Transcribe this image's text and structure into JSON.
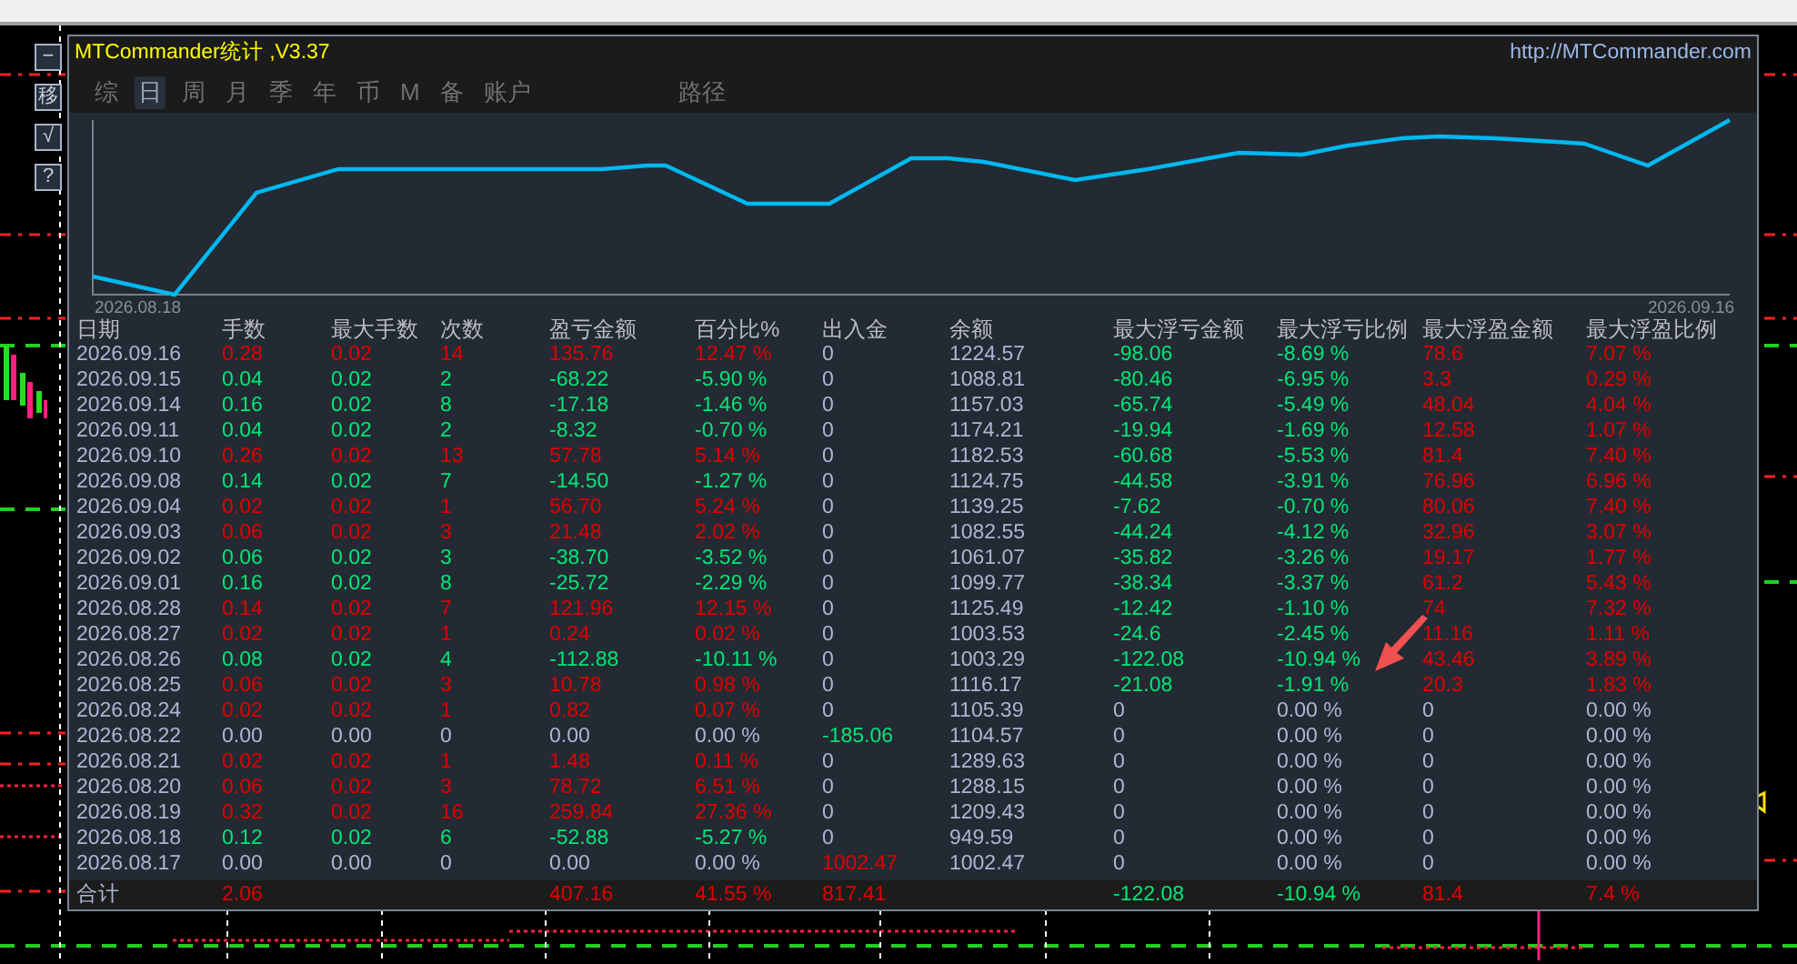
{
  "side_buttons": [
    "−",
    "移",
    "√",
    "?"
  ],
  "window": {
    "title": "MTCommander统计 ,V3.37",
    "link": "http://MTCommander.com"
  },
  "tabs": [
    {
      "label": "综",
      "selected": false
    },
    {
      "label": "日",
      "selected": true
    },
    {
      "label": "周",
      "selected": false
    },
    {
      "label": "月",
      "selected": false
    },
    {
      "label": "季",
      "selected": false
    },
    {
      "label": "年",
      "selected": false
    },
    {
      "label": "币",
      "selected": false
    },
    {
      "label": "M",
      "selected": false
    },
    {
      "label": "备",
      "selected": false
    },
    {
      "label": "账户",
      "selected": false
    },
    {
      "label": "路径",
      "selected": false
    }
  ],
  "equity_chart": {
    "start_label": "2026.08.18",
    "end_label": "2026.09.16"
  },
  "table": {
    "columns": [
      "日期",
      "手数",
      "最大手数",
      "次数",
      "盈亏金额",
      "百分比%",
      "出入金",
      "余额",
      "最大浮亏金额",
      "最大浮亏比例",
      "最大浮盈金额",
      "最大浮盈比例"
    ],
    "rows": [
      {
        "cells": [
          {
            "text": "2026.09.16",
            "color": "#aab6d3"
          },
          {
            "text": "0.28",
            "color": "#e00000"
          },
          {
            "text": "0.02",
            "color": "#e00000"
          },
          {
            "text": "14",
            "color": "#e00000"
          },
          {
            "text": "135.76",
            "color": "#e00000"
          },
          {
            "text": "12.47 %",
            "color": "#e00000"
          },
          {
            "text": "0",
            "color": "#aab6d3"
          },
          {
            "text": "1224.57",
            "color": "#aab6d3"
          },
          {
            "text": "-98.06",
            "color": "#00e676"
          },
          {
            "text": "-8.69 %",
            "color": "#00e676"
          },
          {
            "text": "78.6",
            "color": "#e00000"
          },
          {
            "text": "7.07 %",
            "color": "#e00000"
          }
        ]
      },
      {
        "cells": [
          {
            "text": "2026.09.15",
            "color": "#aab6d3"
          },
          {
            "text": "0.04",
            "color": "#00e676"
          },
          {
            "text": "0.02",
            "color": "#00e676"
          },
          {
            "text": "2",
            "color": "#00e676"
          },
          {
            "text": "-68.22",
            "color": "#00e676"
          },
          {
            "text": "-5.90 %",
            "color": "#00e676"
          },
          {
            "text": "0",
            "color": "#aab6d3"
          },
          {
            "text": "1088.81",
            "color": "#aab6d3"
          },
          {
            "text": "-80.46",
            "color": "#00e676"
          },
          {
            "text": "-6.95 %",
            "color": "#00e676"
          },
          {
            "text": "3.3",
            "color": "#e00000"
          },
          {
            "text": "0.29 %",
            "color": "#e00000"
          }
        ]
      },
      {
        "cells": [
          {
            "text": "2026.09.14",
            "color": "#aab6d3"
          },
          {
            "text": "0.16",
            "color": "#00e676"
          },
          {
            "text": "0.02",
            "color": "#00e676"
          },
          {
            "text": "8",
            "color": "#00e676"
          },
          {
            "text": "-17.18",
            "color": "#00e676"
          },
          {
            "text": "-1.46 %",
            "color": "#00e676"
          },
          {
            "text": "0",
            "color": "#aab6d3"
          },
          {
            "text": "1157.03",
            "color": "#aab6d3"
          },
          {
            "text": "-65.74",
            "color": "#00e676"
          },
          {
            "text": "-5.49 %",
            "color": "#00e676"
          },
          {
            "text": "48.04",
            "color": "#e00000"
          },
          {
            "text": "4.04 %",
            "color": "#e00000"
          }
        ]
      },
      {
        "cells": [
          {
            "text": "2026.09.11",
            "color": "#aab6d3"
          },
          {
            "text": "0.04",
            "color": "#00e676"
          },
          {
            "text": "0.02",
            "color": "#00e676"
          },
          {
            "text": "2",
            "color": "#00e676"
          },
          {
            "text": "-8.32",
            "color": "#00e676"
          },
          {
            "text": "-0.70 %",
            "color": "#00e676"
          },
          {
            "text": "0",
            "color": "#aab6d3"
          },
          {
            "text": "1174.21",
            "color": "#aab6d3"
          },
          {
            "text": "-19.94",
            "color": "#00e676"
          },
          {
            "text": "-1.69 %",
            "color": "#00e676"
          },
          {
            "text": "12.58",
            "color": "#e00000"
          },
          {
            "text": "1.07 %",
            "color": "#e00000"
          }
        ]
      },
      {
        "cells": [
          {
            "text": "2026.09.10",
            "color": "#aab6d3"
          },
          {
            "text": "0.26",
            "color": "#e00000"
          },
          {
            "text": "0.02",
            "color": "#e00000"
          },
          {
            "text": "13",
            "color": "#e00000"
          },
          {
            "text": "57.78",
            "color": "#e00000"
          },
          {
            "text": "5.14 %",
            "color": "#e00000"
          },
          {
            "text": "0",
            "color": "#aab6d3"
          },
          {
            "text": "1182.53",
            "color": "#aab6d3"
          },
          {
            "text": "-60.68",
            "color": "#00e676"
          },
          {
            "text": "-5.53 %",
            "color": "#00e676"
          },
          {
            "text": "81.4",
            "color": "#e00000"
          },
          {
            "text": "7.40 %",
            "color": "#e00000"
          }
        ]
      },
      {
        "cells": [
          {
            "text": "2026.09.08",
            "color": "#aab6d3"
          },
          {
            "text": "0.14",
            "color": "#00e676"
          },
          {
            "text": "0.02",
            "color": "#00e676"
          },
          {
            "text": "7",
            "color": "#00e676"
          },
          {
            "text": "-14.50",
            "color": "#00e676"
          },
          {
            "text": "-1.27 %",
            "color": "#00e676"
          },
          {
            "text": "0",
            "color": "#aab6d3"
          },
          {
            "text": "1124.75",
            "color": "#aab6d3"
          },
          {
            "text": "-44.58",
            "color": "#00e676"
          },
          {
            "text": "-3.91 %",
            "color": "#00e676"
          },
          {
            "text": "76.96",
            "color": "#e00000"
          },
          {
            "text": "6.96 %",
            "color": "#e00000"
          }
        ]
      },
      {
        "cells": [
          {
            "text": "2026.09.04",
            "color": "#aab6d3"
          },
          {
            "text": "0.02",
            "color": "#e00000"
          },
          {
            "text": "0.02",
            "color": "#e00000"
          },
          {
            "text": "1",
            "color": "#e00000"
          },
          {
            "text": "56.70",
            "color": "#e00000"
          },
          {
            "text": "5.24 %",
            "color": "#e00000"
          },
          {
            "text": "0",
            "color": "#aab6d3"
          },
          {
            "text": "1139.25",
            "color": "#aab6d3"
          },
          {
            "text": "-7.62",
            "color": "#00e676"
          },
          {
            "text": "-0.70 %",
            "color": "#00e676"
          },
          {
            "text": "80.06",
            "color": "#e00000"
          },
          {
            "text": "7.40 %",
            "color": "#e00000"
          }
        ]
      },
      {
        "cells": [
          {
            "text": "2026.09.03",
            "color": "#aab6d3"
          },
          {
            "text": "0.06",
            "color": "#e00000"
          },
          {
            "text": "0.02",
            "color": "#e00000"
          },
          {
            "text": "3",
            "color": "#e00000"
          },
          {
            "text": "21.48",
            "color": "#e00000"
          },
          {
            "text": "2.02 %",
            "color": "#e00000"
          },
          {
            "text": "0",
            "color": "#aab6d3"
          },
          {
            "text": "1082.55",
            "color": "#aab6d3"
          },
          {
            "text": "-44.24",
            "color": "#00e676"
          },
          {
            "text": "-4.12 %",
            "color": "#00e676"
          },
          {
            "text": "32.96",
            "color": "#e00000"
          },
          {
            "text": "3.07 %",
            "color": "#e00000"
          }
        ]
      },
      {
        "cells": [
          {
            "text": "2026.09.02",
            "color": "#aab6d3"
          },
          {
            "text": "0.06",
            "color": "#00e676"
          },
          {
            "text": "0.02",
            "color": "#00e676"
          },
          {
            "text": "3",
            "color": "#00e676"
          },
          {
            "text": "-38.70",
            "color": "#00e676"
          },
          {
            "text": "-3.52 %",
            "color": "#00e676"
          },
          {
            "text": "0",
            "color": "#aab6d3"
          },
          {
            "text": "1061.07",
            "color": "#aab6d3"
          },
          {
            "text": "-35.82",
            "color": "#00e676"
          },
          {
            "text": "-3.26 %",
            "color": "#00e676"
          },
          {
            "text": "19.17",
            "color": "#e00000"
          },
          {
            "text": "1.77 %",
            "color": "#e00000"
          }
        ]
      },
      {
        "cells": [
          {
            "text": "2026.09.01",
            "color": "#aab6d3"
          },
          {
            "text": "0.16",
            "color": "#00e676"
          },
          {
            "text": "0.02",
            "color": "#00e676"
          },
          {
            "text": "8",
            "color": "#00e676"
          },
          {
            "text": "-25.72",
            "color": "#00e676"
          },
          {
            "text": "-2.29 %",
            "color": "#00e676"
          },
          {
            "text": "0",
            "color": "#aab6d3"
          },
          {
            "text": "1099.77",
            "color": "#aab6d3"
          },
          {
            "text": "-38.34",
            "color": "#00e676"
          },
          {
            "text": "-3.37 %",
            "color": "#00e676"
          },
          {
            "text": "61.2",
            "color": "#e00000"
          },
          {
            "text": "5.43 %",
            "color": "#e00000"
          }
        ]
      },
      {
        "cells": [
          {
            "text": "2026.08.28",
            "color": "#aab6d3"
          },
          {
            "text": "0.14",
            "color": "#e00000"
          },
          {
            "text": "0.02",
            "color": "#e00000"
          },
          {
            "text": "7",
            "color": "#e00000"
          },
          {
            "text": "121.96",
            "color": "#e00000"
          },
          {
            "text": "12.15 %",
            "color": "#e00000"
          },
          {
            "text": "0",
            "color": "#aab6d3"
          },
          {
            "text": "1125.49",
            "color": "#aab6d3"
          },
          {
            "text": "-12.42",
            "color": "#00e676"
          },
          {
            "text": "-1.10 %",
            "color": "#00e676"
          },
          {
            "text": "74",
            "color": "#e00000"
          },
          {
            "text": "7.32 %",
            "color": "#e00000"
          }
        ]
      },
      {
        "cells": [
          {
            "text": "2026.08.27",
            "color": "#aab6d3"
          },
          {
            "text": "0.02",
            "color": "#e00000"
          },
          {
            "text": "0.02",
            "color": "#e00000"
          },
          {
            "text": "1",
            "color": "#e00000"
          },
          {
            "text": "0.24",
            "color": "#e00000"
          },
          {
            "text": "0.02 %",
            "color": "#e00000"
          },
          {
            "text": "0",
            "color": "#aab6d3"
          },
          {
            "text": "1003.53",
            "color": "#aab6d3"
          },
          {
            "text": "-24.6",
            "color": "#00e676"
          },
          {
            "text": "-2.45 %",
            "color": "#00e676"
          },
          {
            "text": "11.16",
            "color": "#e00000"
          },
          {
            "text": "1.11 %",
            "color": "#e00000"
          }
        ]
      },
      {
        "cells": [
          {
            "text": "2026.08.26",
            "color": "#aab6d3"
          },
          {
            "text": "0.08",
            "color": "#00e676"
          },
          {
            "text": "0.02",
            "color": "#00e676"
          },
          {
            "text": "4",
            "color": "#00e676"
          },
          {
            "text": "-112.88",
            "color": "#00e676"
          },
          {
            "text": "-10.11 %",
            "color": "#00e676"
          },
          {
            "text": "0",
            "color": "#aab6d3"
          },
          {
            "text": "1003.29",
            "color": "#aab6d3"
          },
          {
            "text": "-122.08",
            "color": "#00e676"
          },
          {
            "text": "-10.94 %",
            "color": "#00e676"
          },
          {
            "text": "43.46",
            "color": "#e00000"
          },
          {
            "text": "3.89 %",
            "color": "#e00000"
          }
        ]
      },
      {
        "cells": [
          {
            "text": "2026.08.25",
            "color": "#aab6d3"
          },
          {
            "text": "0.06",
            "color": "#e00000"
          },
          {
            "text": "0.02",
            "color": "#e00000"
          },
          {
            "text": "3",
            "color": "#e00000"
          },
          {
            "text": "10.78",
            "color": "#e00000"
          },
          {
            "text": "0.98 %",
            "color": "#e00000"
          },
          {
            "text": "0",
            "color": "#aab6d3"
          },
          {
            "text": "1116.17",
            "color": "#aab6d3"
          },
          {
            "text": "-21.08",
            "color": "#00e676"
          },
          {
            "text": "-1.91 %",
            "color": "#00e676"
          },
          {
            "text": "20.3",
            "color": "#e00000"
          },
          {
            "text": "1.83 %",
            "color": "#e00000"
          }
        ]
      },
      {
        "cells": [
          {
            "text": "2026.08.24",
            "color": "#aab6d3"
          },
          {
            "text": "0.02",
            "color": "#e00000"
          },
          {
            "text": "0.02",
            "color": "#e00000"
          },
          {
            "text": "1",
            "color": "#e00000"
          },
          {
            "text": "0.82",
            "color": "#e00000"
          },
          {
            "text": "0.07 %",
            "color": "#e00000"
          },
          {
            "text": "0",
            "color": "#aab6d3"
          },
          {
            "text": "1105.39",
            "color": "#aab6d3"
          },
          {
            "text": "0",
            "color": "#aab6d3"
          },
          {
            "text": "0.00 %",
            "color": "#aab6d3"
          },
          {
            "text": "0",
            "color": "#aab6d3"
          },
          {
            "text": "0.00 %",
            "color": "#aab6d3"
          }
        ]
      },
      {
        "cells": [
          {
            "text": "2026.08.22",
            "color": "#aab6d3"
          },
          {
            "text": "0.00",
            "color": "#aab6d3"
          },
          {
            "text": "0.00",
            "color": "#aab6d3"
          },
          {
            "text": "0",
            "color": "#aab6d3"
          },
          {
            "text": "0.00",
            "color": "#aab6d3"
          },
          {
            "text": "0.00 %",
            "color": "#aab6d3"
          },
          {
            "text": "-185.06",
            "color": "#00e676"
          },
          {
            "text": "1104.57",
            "color": "#aab6d3"
          },
          {
            "text": "0",
            "color": "#aab6d3"
          },
          {
            "text": "0.00 %",
            "color": "#aab6d3"
          },
          {
            "text": "0",
            "color": "#aab6d3"
          },
          {
            "text": "0.00 %",
            "color": "#aab6d3"
          }
        ]
      },
      {
        "cells": [
          {
            "text": "2026.08.21",
            "color": "#aab6d3"
          },
          {
            "text": "0.02",
            "color": "#e00000"
          },
          {
            "text": "0.02",
            "color": "#e00000"
          },
          {
            "text": "1",
            "color": "#e00000"
          },
          {
            "text": "1.48",
            "color": "#e00000"
          },
          {
            "text": "0.11 %",
            "color": "#e00000"
          },
          {
            "text": "0",
            "color": "#aab6d3"
          },
          {
            "text": "1289.63",
            "color": "#aab6d3"
          },
          {
            "text": "0",
            "color": "#aab6d3"
          },
          {
            "text": "0.00 %",
            "color": "#aab6d3"
          },
          {
            "text": "0",
            "color": "#aab6d3"
          },
          {
            "text": "0.00 %",
            "color": "#aab6d3"
          }
        ]
      },
      {
        "cells": [
          {
            "text": "2026.08.20",
            "color": "#aab6d3"
          },
          {
            "text": "0.06",
            "color": "#e00000"
          },
          {
            "text": "0.02",
            "color": "#e00000"
          },
          {
            "text": "3",
            "color": "#e00000"
          },
          {
            "text": "78.72",
            "color": "#e00000"
          },
          {
            "text": "6.51 %",
            "color": "#e00000"
          },
          {
            "text": "0",
            "color": "#aab6d3"
          },
          {
            "text": "1288.15",
            "color": "#aab6d3"
          },
          {
            "text": "0",
            "color": "#aab6d3"
          },
          {
            "text": "0.00 %",
            "color": "#aab6d3"
          },
          {
            "text": "0",
            "color": "#aab6d3"
          },
          {
            "text": "0.00 %",
            "color": "#aab6d3"
          }
        ]
      },
      {
        "cells": [
          {
            "text": "2026.08.19",
            "color": "#aab6d3"
          },
          {
            "text": "0.32",
            "color": "#e00000"
          },
          {
            "text": "0.02",
            "color": "#e00000"
          },
          {
            "text": "16",
            "color": "#e00000"
          },
          {
            "text": "259.84",
            "color": "#e00000"
          },
          {
            "text": "27.36 %",
            "color": "#e00000"
          },
          {
            "text": "0",
            "color": "#aab6d3"
          },
          {
            "text": "1209.43",
            "color": "#aab6d3"
          },
          {
            "text": "0",
            "color": "#aab6d3"
          },
          {
            "text": "0.00 %",
            "color": "#aab6d3"
          },
          {
            "text": "0",
            "color": "#aab6d3"
          },
          {
            "text": "0.00 %",
            "color": "#aab6d3"
          }
        ]
      },
      {
        "cells": [
          {
            "text": "2026.08.18",
            "color": "#aab6d3"
          },
          {
            "text": "0.12",
            "color": "#00e676"
          },
          {
            "text": "0.02",
            "color": "#00e676"
          },
          {
            "text": "6",
            "color": "#00e676"
          },
          {
            "text": "-52.88",
            "color": "#00e676"
          },
          {
            "text": "-5.27 %",
            "color": "#00e676"
          },
          {
            "text": "0",
            "color": "#aab6d3"
          },
          {
            "text": "949.59",
            "color": "#aab6d3"
          },
          {
            "text": "0",
            "color": "#aab6d3"
          },
          {
            "text": "0.00 %",
            "color": "#aab6d3"
          },
          {
            "text": "0",
            "color": "#aab6d3"
          },
          {
            "text": "0.00 %",
            "color": "#aab6d3"
          }
        ]
      },
      {
        "cells": [
          {
            "text": "2026.08.17",
            "color": "#aab6d3"
          },
          {
            "text": "0.00",
            "color": "#aab6d3"
          },
          {
            "text": "0.00",
            "color": "#aab6d3"
          },
          {
            "text": "0",
            "color": "#aab6d3"
          },
          {
            "text": "0.00",
            "color": "#aab6d3"
          },
          {
            "text": "0.00 %",
            "color": "#aab6d3"
          },
          {
            "text": "1002.47",
            "color": "#e00000"
          },
          {
            "text": "1002.47",
            "color": "#aab6d3"
          },
          {
            "text": "0",
            "color": "#aab6d3"
          },
          {
            "text": "0.00 %",
            "color": "#aab6d3"
          },
          {
            "text": "0",
            "color": "#aab6d3"
          },
          {
            "text": "0.00 %",
            "color": "#aab6d3"
          }
        ]
      }
    ],
    "total": {
      "cells": [
        {
          "text": "合计",
          "color": "#aab6d3"
        },
        {
          "text": "2.06",
          "color": "#e00000"
        },
        {},
        {},
        {
          "text": "407.16",
          "color": "#e00000"
        },
        {
          "text": "41.55 %",
          "color": "#e00000"
        },
        {
          "text": "817.41",
          "color": "#e00000"
        },
        {},
        {
          "text": "-122.08",
          "color": "#00e676"
        },
        {
          "text": "-10.94 %",
          "color": "#00e676"
        },
        {
          "text": "81.4",
          "color": "#e00000"
        },
        {
          "text": "7.4 %",
          "color": "#e00000"
        }
      ]
    }
  }
}
